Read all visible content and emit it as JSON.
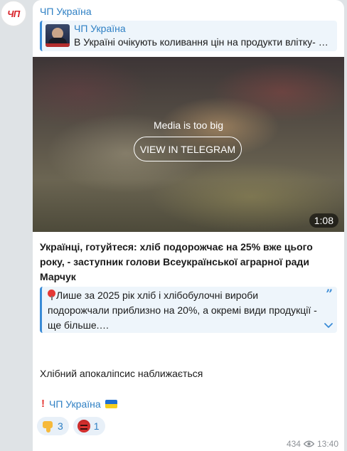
{
  "channel": {
    "avatar_text": "ЧП",
    "name": "ЧП Україна"
  },
  "forwarded": {
    "title": "ЧП Україна",
    "text": "В Україні очікують коливання цін на продукти влітку- Деталі"
  },
  "media": {
    "message": "Media is too big",
    "button_label": "VIEW IN TELEGRAM",
    "duration": "1:08"
  },
  "post": {
    "headline": "Українці, готуйтеся: хліб подорожчає на 25% вже цього року, - заступник голови Всеукраїнської аграрної ради Марчук",
    "quote_text": "Лише за 2025 рік хліб і хлібобулочні вироби подорожчали приблизно на 20%, а окремі види продукції - ще більше.…",
    "closing": "Хлібний апокаліпсис наближається",
    "signature": "ЧП Україна"
  },
  "reactions": [
    {
      "icon": "thumbs-down-icon",
      "count": "3"
    },
    {
      "icon": "angry-face-icon",
      "count": "1"
    }
  ],
  "meta": {
    "views": "434",
    "time": "13:40"
  },
  "colors": {
    "accent": "#2f80c4",
    "quote_bg": "#eef5fb",
    "background": "#dfe3e6"
  }
}
